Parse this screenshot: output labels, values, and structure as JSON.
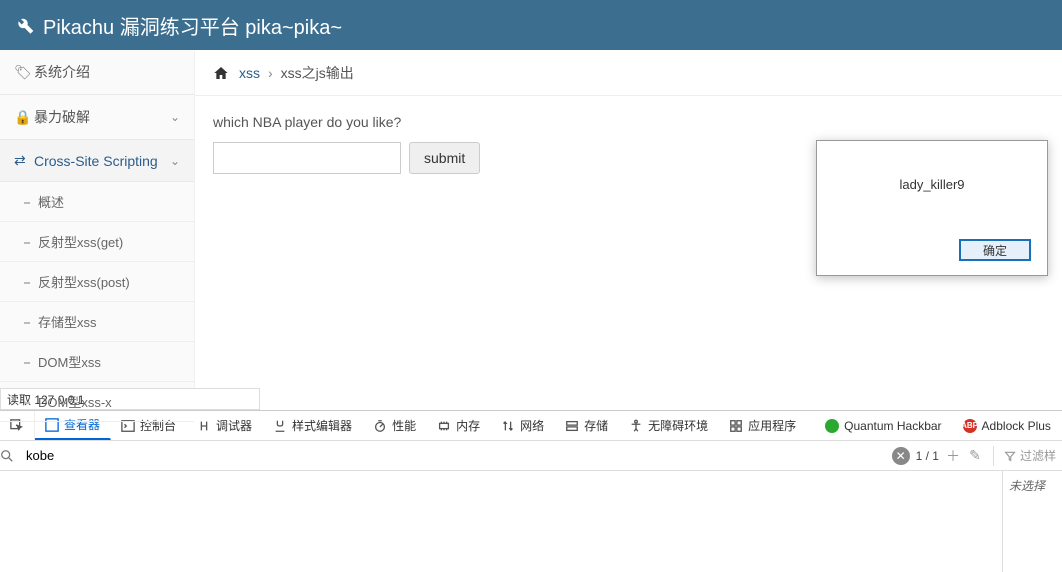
{
  "header": {
    "title": "Pikachu 漏洞练习平台 pika~pika~"
  },
  "sidebar": {
    "items": [
      {
        "label": "系统介绍",
        "icon": "tag-icon"
      },
      {
        "label": "暴力破解",
        "icon": "lock-icon"
      },
      {
        "label": "Cross-Site Scripting",
        "icon": "flow-icon",
        "active": true
      }
    ],
    "subs": [
      {
        "label": "概述"
      },
      {
        "label": "反射型xss(get)"
      },
      {
        "label": "反射型xss(post)"
      },
      {
        "label": "存储型xss"
      },
      {
        "label": "DOM型xss"
      },
      {
        "label": "DOM型xss-x"
      }
    ]
  },
  "breadcrumb": {
    "link": "xss",
    "current": "xss之js输出"
  },
  "content": {
    "question": "which NBA player do you like?",
    "submit_label": "submit",
    "input_value": ""
  },
  "alert": {
    "message": "lady_killer9",
    "ok": "确定"
  },
  "status": {
    "text": "读取 127.0.0.1"
  },
  "devtools": {
    "tabs": [
      {
        "label": "查看器",
        "icon": "inspector-icon",
        "active": true
      },
      {
        "label": "控制台",
        "icon": "console-icon"
      },
      {
        "label": "调试器",
        "icon": "debugger-icon"
      },
      {
        "label": "样式编辑器",
        "icon": "style-icon"
      },
      {
        "label": "性能",
        "icon": "perf-icon"
      },
      {
        "label": "内存",
        "icon": "memory-icon"
      },
      {
        "label": "网络",
        "icon": "network-icon"
      },
      {
        "label": "存储",
        "icon": "storage-icon"
      },
      {
        "label": "无障碍环境",
        "icon": "a11y-icon"
      },
      {
        "label": "应用程序",
        "icon": "app-icon"
      }
    ],
    "extensions": [
      {
        "label": "Quantum Hackbar",
        "icon": "green-dot"
      },
      {
        "label": "Adblock Plus",
        "icon": "red-abp"
      }
    ],
    "search": {
      "value": "kobe",
      "counter": "1 / 1",
      "filter_label": "过滤样",
      "no_select": "未选择"
    }
  }
}
